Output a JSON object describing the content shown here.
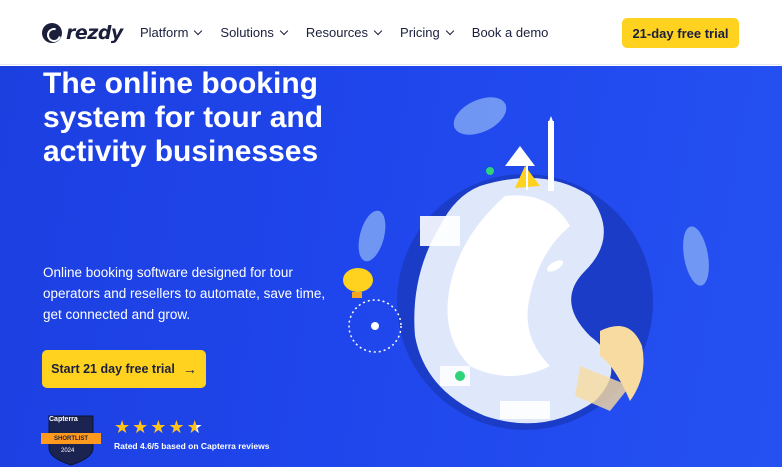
{
  "nav": {
    "logo_text": "rezdy",
    "menu": [
      {
        "label": "Platform",
        "has_dropdown": true
      },
      {
        "label": "Solutions",
        "has_dropdown": true
      },
      {
        "label": "Resources",
        "has_dropdown": true
      },
      {
        "label": "Pricing",
        "has_dropdown": true
      },
      {
        "label": "Book a demo",
        "has_dropdown": false
      }
    ],
    "trial_button": "21-day free trial"
  },
  "hero": {
    "title": "The online booking system for tour and activity businesses",
    "description": "Online booking software designed for tour operators and resellers to automate, save time, get connected and grow.",
    "cta_label": "Start 21 day free trial",
    "cta_icon": "arrow-right-icon",
    "badge": {
      "brand": "Capterra",
      "ribbon": "SHORTLIST",
      "year": "2024"
    },
    "rating": {
      "stars": 4.6,
      "max": 5,
      "text": "Rated 4.6/5 based on Capterra reviews"
    },
    "illustration": "globe-travel-illustration"
  },
  "colors": {
    "brand_blue": "#1f46ec",
    "accent_yellow": "#ffd21f",
    "text_dark": "#1b1f3b",
    "star": "#ffc21a"
  }
}
